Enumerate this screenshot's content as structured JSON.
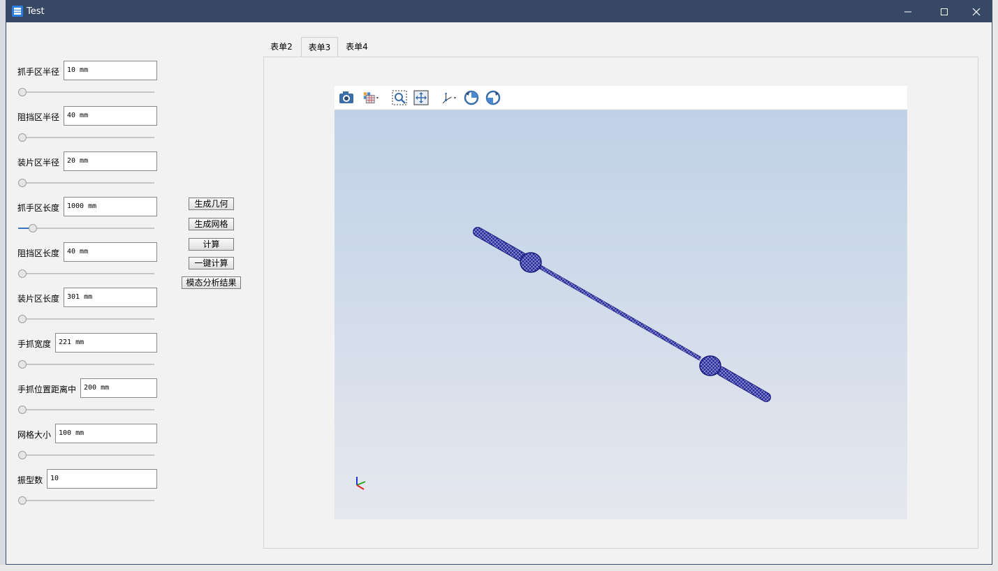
{
  "window": {
    "title": "Test",
    "controls": {
      "minimize": "minimize-icon",
      "maximize": "maximize-icon",
      "close": "close-icon"
    }
  },
  "params": [
    {
      "label": "抓手区半径",
      "value": "10 mm",
      "slider": 0.0
    },
    {
      "label": "阻挡区半径",
      "value": "40 mm",
      "slider": 0.0
    },
    {
      "label": "装片区半径",
      "value": "20 mm",
      "slider": 0.0
    },
    {
      "label": "抓手区长度",
      "value": "1000 mm",
      "slider": 0.08
    },
    {
      "label": "阻挡区长度",
      "value": "40 mm",
      "slider": 0.0
    },
    {
      "label": "装片区长度",
      "value": "301 mm",
      "slider": 0.0
    },
    {
      "label": "手抓宽度",
      "value": "221 mm",
      "slider": 0.0
    },
    {
      "label": "手抓位置距离中",
      "value": "200 mm",
      "slider": 0.0
    },
    {
      "label": "网格大小",
      "value": "100 mm",
      "slider": 0.0
    },
    {
      "label": "振型数",
      "value": "10",
      "slider": 0.0
    }
  ],
  "actions": {
    "gen_geometry": "生成几何",
    "gen_mesh": "生成网格",
    "compute": "计算",
    "one_click": "一键计算",
    "modal_results": "模态分析结果"
  },
  "tabs": [
    {
      "label": "表单2",
      "active": false
    },
    {
      "label": "表单3",
      "active": true
    },
    {
      "label": "表单4",
      "active": false
    }
  ],
  "viewer": {
    "toolbar": [
      "camera-icon",
      "display-mode-icon",
      "zoom-window-icon",
      "fit-all-icon",
      "axes-orientation-icon",
      "rotate-left-icon",
      "rotate-right-icon"
    ],
    "background_top": "#bfd1e7",
    "background_bottom": "#e6e8ee",
    "mesh_color": "#1a1a7a"
  }
}
